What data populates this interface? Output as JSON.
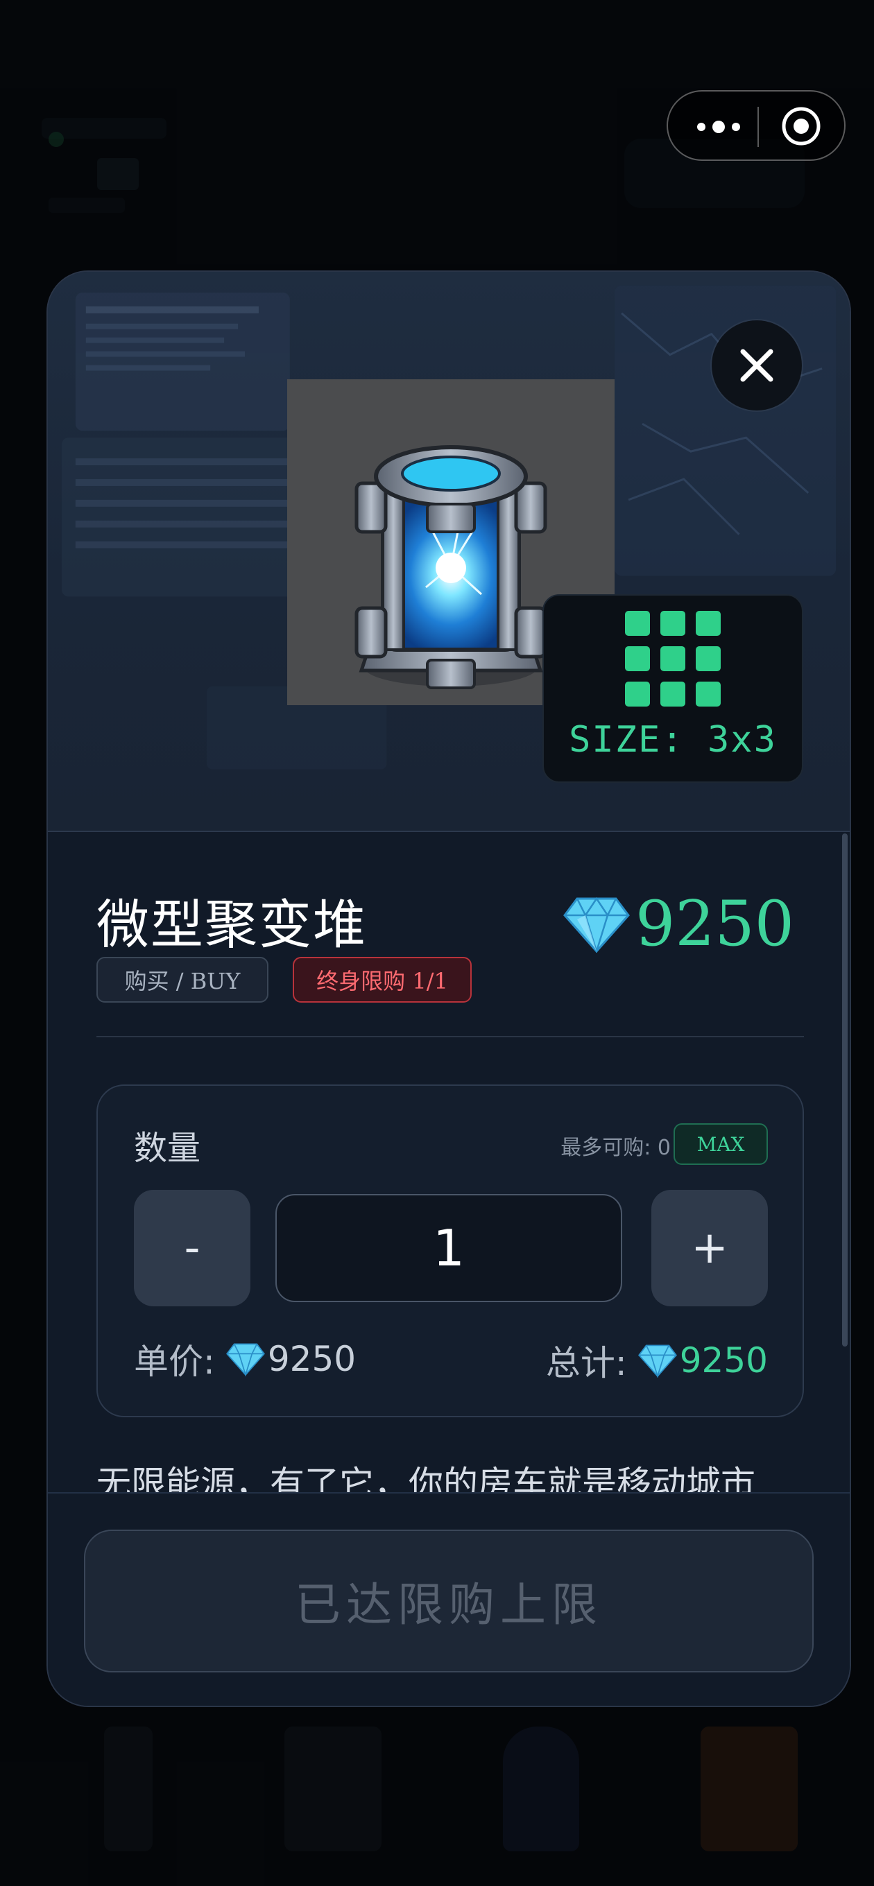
{
  "item": {
    "title": "微型聚变堆",
    "price": "9250",
    "size_label": "SIZE: 3x3",
    "tag_buy": "购买 / BUY",
    "tag_limit": "终身限购 1/1"
  },
  "quantity": {
    "label": "数量",
    "max_hint": "最多可购: 0",
    "max_button": "MAX",
    "minus_label": "-",
    "plus_label": "+",
    "value": "1",
    "unit_price_label": "单价:",
    "unit_price_value": "9250",
    "total_label": "总计:",
    "total_value": "9250"
  },
  "description": "无限能源，有了它，你的房车就是移动城市",
  "footer": {
    "button_label": "已达限购上限"
  },
  "colors": {
    "accent_green": "#3ed39a",
    "limit_red": "#ff6b71",
    "modal_bg": "#111a28"
  },
  "icons": {
    "close": "close-icon",
    "gem": "diamond-gem-icon",
    "capsule_more": "more-dots-icon",
    "capsule_target": "target-icon"
  }
}
